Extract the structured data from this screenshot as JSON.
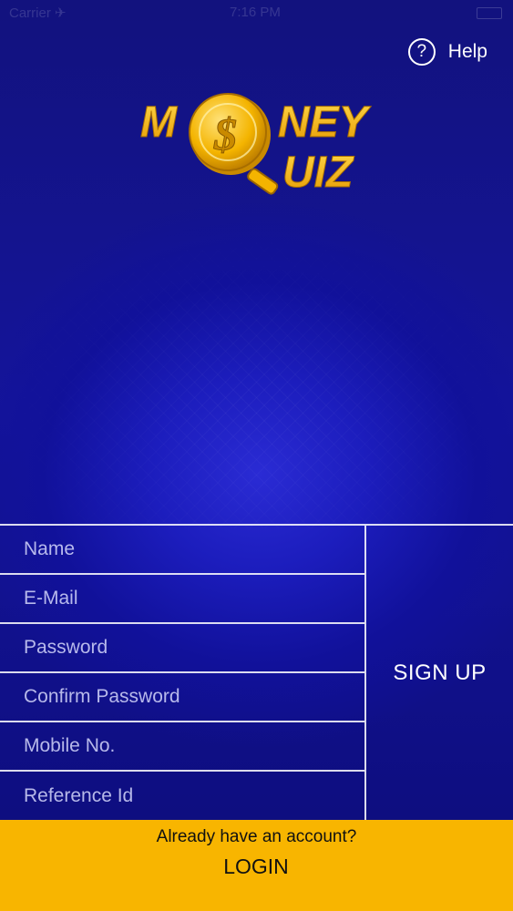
{
  "status_bar": {
    "carrier": "Carrier ✈",
    "time": "7:16 PM"
  },
  "help": {
    "icon": "question-circle-icon",
    "label": "Help"
  },
  "logo": {
    "line1_left": "M",
    "line1_right": "NEY",
    "line2": "UIZ",
    "coin_symbol": "$",
    "colors": {
      "gold": "#f5b800",
      "gold_dark": "#c98a00",
      "gold_light": "#ffd84a"
    }
  },
  "form": {
    "fields": [
      {
        "name": "name-field",
        "placeholder": "Name",
        "value": ""
      },
      {
        "name": "email-field",
        "placeholder": "E-Mail",
        "value": ""
      },
      {
        "name": "password-field",
        "placeholder": "Password",
        "value": ""
      },
      {
        "name": "confirm-password-field",
        "placeholder": "Confirm Password",
        "value": ""
      },
      {
        "name": "mobile-field",
        "placeholder": "Mobile No.",
        "value": ""
      },
      {
        "name": "reference-id-field",
        "placeholder": "Reference Id",
        "value": ""
      }
    ],
    "signup_label": "SIGN UP"
  },
  "footer": {
    "question": "Already have an account?",
    "login_label": "LOGIN",
    "background": "#f8b500"
  }
}
